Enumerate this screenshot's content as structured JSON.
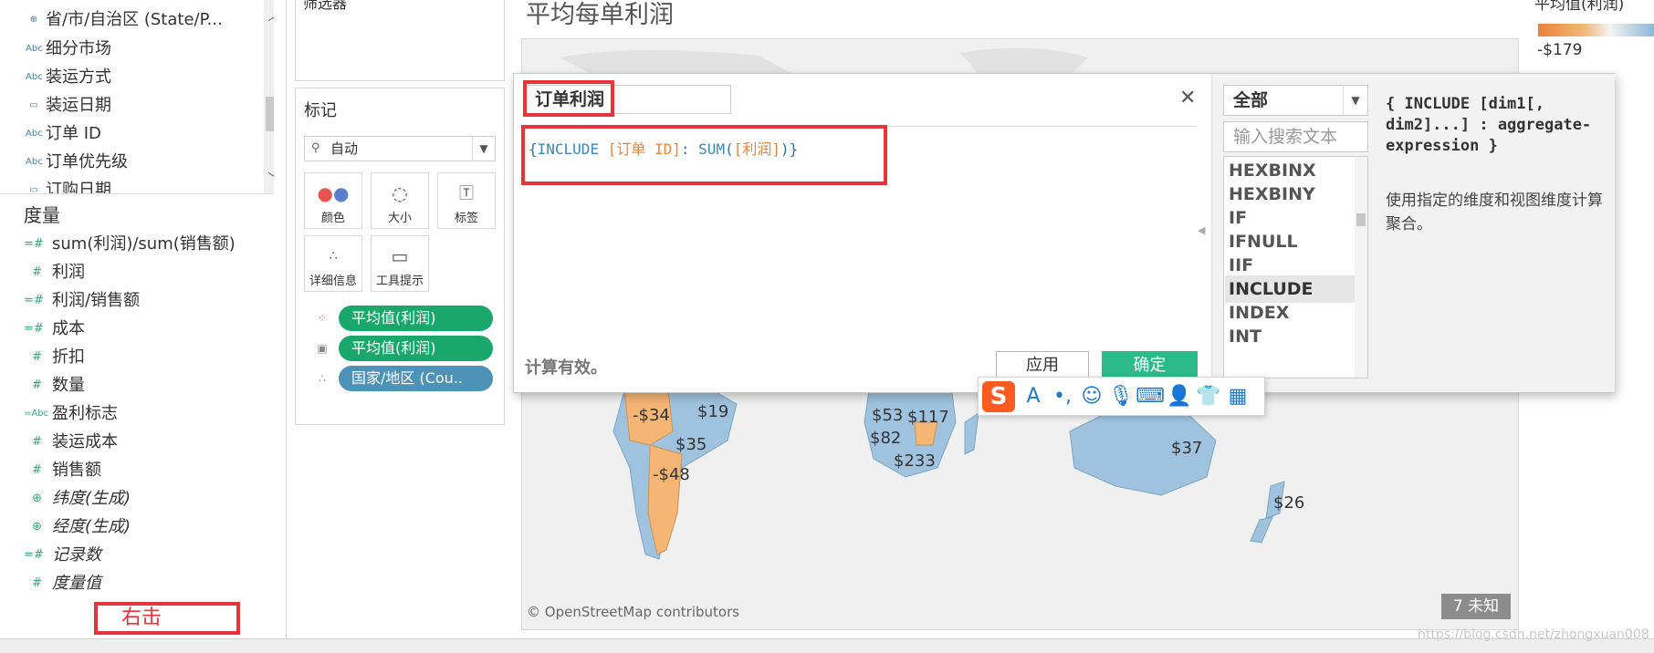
{
  "data_pane": {
    "dimensions": [
      {
        "icon": "globe-icon",
        "glyph": "⊕",
        "label": "省/市/自治区 (State/P..."
      },
      {
        "icon": "abc-icon",
        "glyph": "Abc",
        "label": "细分市场"
      },
      {
        "icon": "abc-icon",
        "glyph": "Abc",
        "label": "装运方式"
      },
      {
        "icon": "calendar-icon",
        "glyph": "▭",
        "label": "装运日期"
      },
      {
        "icon": "abc-icon",
        "glyph": "Abc",
        "label": "订单 ID"
      },
      {
        "icon": "abc-icon",
        "glyph": "Abc",
        "label": "订单优先级"
      },
      {
        "icon": "calendar-icon",
        "glyph": "▭",
        "label": "订购日期"
      }
    ],
    "measures_title": "度量",
    "measures": [
      {
        "icon": "calc-number-icon",
        "glyph": "=#",
        "label": "sum(利润)/sum(销售额)",
        "italic": false
      },
      {
        "icon": "number-icon",
        "glyph": "#",
        "label": "利润",
        "italic": false
      },
      {
        "icon": "calc-number-icon",
        "glyph": "=#",
        "label": "利润/销售额",
        "italic": false
      },
      {
        "icon": "calc-number-icon",
        "glyph": "=#",
        "label": "成本",
        "italic": false
      },
      {
        "icon": "number-icon",
        "glyph": "#",
        "label": "折扣",
        "italic": false
      },
      {
        "icon": "number-icon",
        "glyph": "#",
        "label": "数量",
        "italic": false
      },
      {
        "icon": "calc-abc-icon",
        "glyph": "=Abc",
        "label": "盈利标志",
        "italic": false
      },
      {
        "icon": "number-icon",
        "glyph": "#",
        "label": "装运成本",
        "italic": false
      },
      {
        "icon": "number-icon",
        "glyph": "#",
        "label": "销售额",
        "italic": false
      },
      {
        "icon": "globe-icon",
        "glyph": "⊕",
        "label": "纬度(生成)",
        "italic": true
      },
      {
        "icon": "globe-icon",
        "glyph": "⊕",
        "label": "经度(生成)",
        "italic": true
      },
      {
        "icon": "calc-number-icon",
        "glyph": "=#",
        "label": "记录数",
        "italic": true
      },
      {
        "icon": "number-icon",
        "glyph": "#",
        "label": "度量值",
        "italic": true
      }
    ],
    "annotation": "右击"
  },
  "filters": {
    "title": "筛选器"
  },
  "marks": {
    "title": "标记",
    "mark_type": "自动",
    "buttons": [
      {
        "name": "color",
        "label": "颜色"
      },
      {
        "name": "size",
        "label": "大小"
      },
      {
        "name": "label",
        "label": "标签"
      },
      {
        "name": "detail",
        "label": "详细信息"
      },
      {
        "name": "tooltip",
        "label": "工具提示"
      }
    ],
    "pills": [
      {
        "label": "平均值(利润)",
        "color": "#1aa76c"
      },
      {
        "label": "平均值(利润)",
        "color": "#1aa76c"
      },
      {
        "label": "国家/地区 (Cou..",
        "color": "#4e92b8"
      }
    ]
  },
  "sheet": {
    "title": "平均每单利润",
    "map_labels": [
      "-$34",
      "$19",
      "$35",
      "-$48",
      "$53",
      "$117",
      "$82",
      "$233",
      "$37",
      "$26"
    ],
    "credit": "© OpenStreetMap contributors",
    "unknown_badge": "7 未知",
    "colors": {
      "positive": "#9fc3de",
      "negative": "#f5b574"
    }
  },
  "legend": {
    "title": "平均值(利润)",
    "min_label": "-$179"
  },
  "calc_dialog": {
    "name": "订单利润",
    "formula": {
      "open": "{",
      "keyword": "INCLUDE",
      "field1": "[订单 ID]",
      "colon": ":",
      "func": "SUM",
      "paren_open": "(",
      "field2": "[利润]",
      "paren_close": ")",
      "close": "}"
    },
    "status": "计算有效。",
    "apply_label": "应用",
    "ok_label": "确定",
    "category": "全部",
    "search_placeholder": "输入搜索文本",
    "functions": [
      "HEXBINX",
      "HEXBINY",
      "IF",
      "IFNULL",
      "IIF",
      "INCLUDE",
      "INDEX",
      "INT"
    ],
    "selected_function": "INCLUDE",
    "syntax": "{ INCLUDE [dim1[, dim2]...] : aggregate-expression }",
    "description": "使用指定的维度和视图维度计算聚合。"
  },
  "watermark": "https://blog.csdn.net/zhongxuan008"
}
